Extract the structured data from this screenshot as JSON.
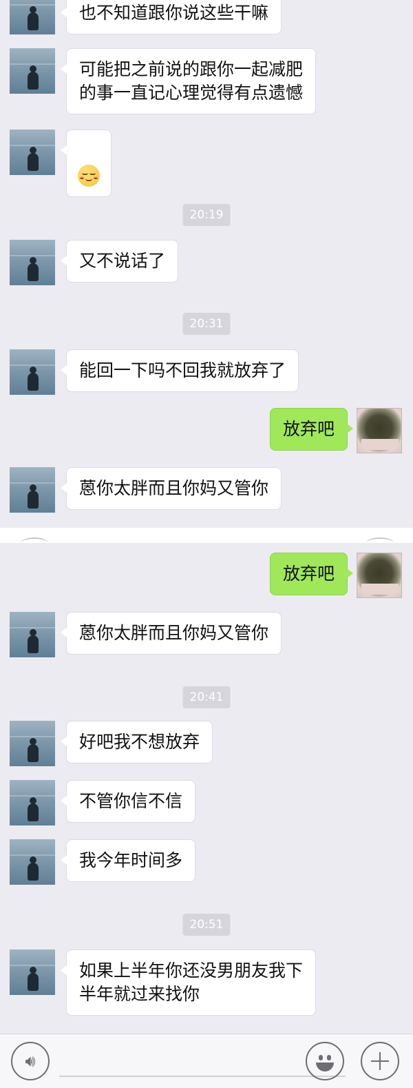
{
  "chat": {
    "panel1": {
      "m1": "也不知道跟你说这些干嘛",
      "m2": "可能把之前说的跟你一起减肥\n的事一直记心理觉得有点遗憾",
      "m3_emoji": "relieved-face-emoji",
      "t1": "20:19",
      "m4": "又不说话了",
      "t2": "20:31",
      "m5": "能回一下吗不回我就放弃了",
      "m6_self": "放弃吧",
      "m7": "蒽你太胖而且你妈又管你"
    },
    "panel2": {
      "m1_self": "放弃吧",
      "m2": "蒽你太胖而且你妈又管你",
      "t1": "20:41",
      "m3": "好吧我不想放弃",
      "m4": "不管你信不信",
      "m5": "我今年时间多",
      "t2": "20:51",
      "m6": "如果上半年你还没男朋友我下\n半年就过来找你"
    }
  },
  "input_bar": {
    "voice_icon": "voice-icon",
    "emoji_icon": "emoji-icon",
    "plus_icon": "plus-icon"
  },
  "colors": {
    "background": "#ecebf1",
    "self_bubble": "#a0e75a",
    "other_bubble": "#ffffff",
    "timestamp_bg": "#d6d5dc"
  }
}
